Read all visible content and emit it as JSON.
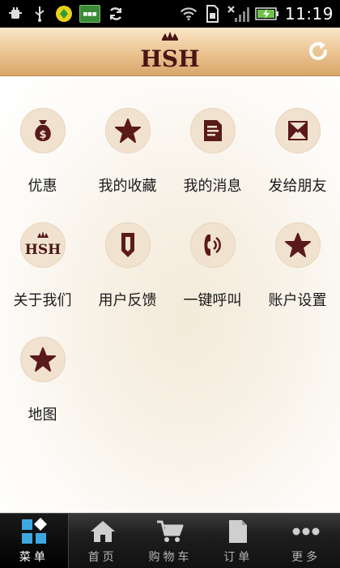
{
  "status_bar": {
    "time": "11:19",
    "left_icons": [
      "usb-debug-icon",
      "usb-icon",
      "app-notification-icon",
      "app-notification-icon",
      "sync-icon"
    ],
    "right_icons": [
      "wifi-icon",
      "sim-icon",
      "signal-icon",
      "battery-charging-icon"
    ]
  },
  "header": {
    "logo_text": "HSH"
  },
  "grid": [
    {
      "label": "优惠",
      "icon": "money-bag-icon"
    },
    {
      "label": "我的收藏",
      "icon": "star-icon"
    },
    {
      "label": "我的消息",
      "icon": "document-icon"
    },
    {
      "label": "发给朋友",
      "icon": "envelope-icon"
    },
    {
      "label": "关于我们",
      "icon": "hsh-logo-icon"
    },
    {
      "label": "用户反馈",
      "icon": "pen-icon"
    },
    {
      "label": "一键呼叫",
      "icon": "phone-icon"
    },
    {
      "label": "账户设置",
      "icon": "star-icon"
    },
    {
      "label": "地图",
      "icon": "star-icon"
    }
  ],
  "tabs": [
    {
      "label": "菜单",
      "icon": "menu-grid-icon",
      "active": true
    },
    {
      "label": "首页",
      "icon": "home-icon",
      "active": false
    },
    {
      "label": "购物车",
      "icon": "cart-icon",
      "active": false
    },
    {
      "label": "订单",
      "icon": "order-icon",
      "active": false
    },
    {
      "label": "更多",
      "icon": "more-icon",
      "active": false
    }
  ],
  "colors": {
    "icon_dark": "#5a1a1a",
    "circle_bg": "#f1e2cf",
    "header_top": "#fbe7c9",
    "header_bottom": "#d9a66a",
    "active_blue": "#3da7e0"
  }
}
